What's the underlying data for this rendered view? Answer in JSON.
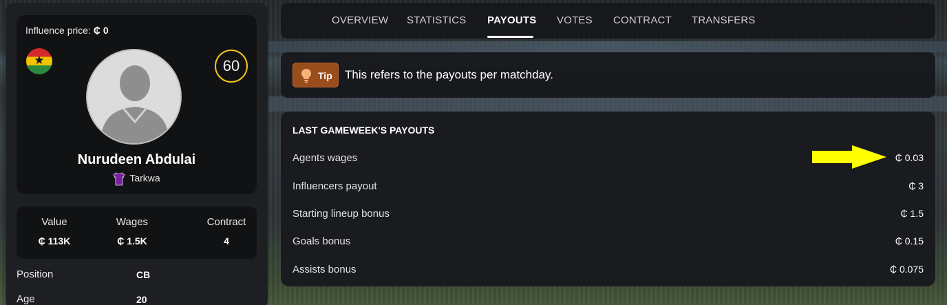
{
  "player_card": {
    "influence_label": "Influence price:",
    "influence_currency": "₵",
    "influence_value": "0",
    "rating": "60",
    "name": "Nurudeen Abdulai",
    "club": "Tarkwa",
    "flag": "ghana-flag",
    "club_shirt_color": "#7b1fa2"
  },
  "stats": [
    {
      "label": "Value",
      "value": "₵ 113K"
    },
    {
      "label": "Wages",
      "value": "₵ 1.5K"
    },
    {
      "label": "Contract",
      "value": "4"
    }
  ],
  "details": [
    {
      "label": "Position",
      "value": "CB"
    },
    {
      "label": "Age",
      "value": "20"
    }
  ],
  "tabs": [
    {
      "label": "OVERVIEW",
      "active": false
    },
    {
      "label": "STATISTICS",
      "active": false
    },
    {
      "label": "PAYOUTS",
      "active": true
    },
    {
      "label": "VOTES",
      "active": false
    },
    {
      "label": "CONTRACT",
      "active": false
    },
    {
      "label": "TRANSFERS",
      "active": false
    }
  ],
  "tip": {
    "badge": "Tip",
    "text": "This refers to the payouts per matchday."
  },
  "payouts": {
    "title": "LAST GAMEWEEK'S PAYOUTS",
    "rows": [
      {
        "label": "Agents wages",
        "value": "₵ 0.03"
      },
      {
        "label": "Influencers payout",
        "value": "₵ 3"
      },
      {
        "label": "Starting lineup bonus",
        "value": "₵ 1.5"
      },
      {
        "label": "Goals bonus",
        "value": "₵ 0.15"
      },
      {
        "label": "Assists bonus",
        "value": "₵ 0.075"
      }
    ]
  },
  "colors": {
    "rating_ring": "#f5c518",
    "tip_badge": "#9a4d1c",
    "annotation_arrow": "#ffff00"
  }
}
